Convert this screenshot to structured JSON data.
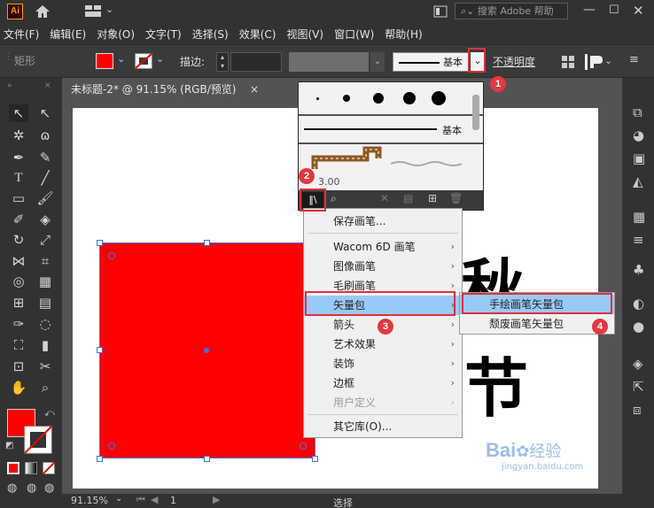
{
  "title_bar": {
    "logo": "Ai",
    "search_placeholder": "搜索 Adobe 帮助"
  },
  "menu": [
    "文件(F)",
    "编辑(E)",
    "对象(O)",
    "文字(T)",
    "选择(S)",
    "效果(C)",
    "视图(V)",
    "窗口(W)",
    "帮助(H)"
  ],
  "control_bar": {
    "shape_label": "矩形",
    "stroke_label": "描边:",
    "brush_profile": "基本",
    "opacity_label": "不透明度",
    "fill_color": "#fe0000"
  },
  "document": {
    "tab_title": "未标题-2* @ 91.15% (RGB/预览)",
    "text_chars": [
      "秋",
      "节"
    ],
    "rect_color": "#fe0000"
  },
  "brush_panel": {
    "basic_label": "基本",
    "size_label": "3.00"
  },
  "context_menu": {
    "items": [
      {
        "label": "保存画笔...",
        "submenu": false,
        "disabled": false
      },
      {
        "label": "Wacom 6D 画笔",
        "submenu": true,
        "disabled": false
      },
      {
        "label": "图像画笔",
        "submenu": true,
        "disabled": false
      },
      {
        "label": "毛刷画笔",
        "submenu": true,
        "disabled": false
      },
      {
        "label": "矢量包",
        "submenu": true,
        "disabled": false,
        "highlight": true
      },
      {
        "label": "箭头",
        "submenu": true,
        "disabled": false
      },
      {
        "label": "艺术效果",
        "submenu": true,
        "disabled": false
      },
      {
        "label": "装饰",
        "submenu": true,
        "disabled": false
      },
      {
        "label": "边框",
        "submenu": true,
        "disabled": false
      },
      {
        "label": "用户定义",
        "submenu": true,
        "disabled": true
      },
      {
        "label": "其它库(O)...",
        "submenu": false,
        "disabled": false
      }
    ],
    "submenu_items": [
      "手绘画笔矢量包",
      "颓废画笔矢量包"
    ]
  },
  "annotations": [
    "1",
    "2",
    "3",
    "4"
  ],
  "status_bar": {
    "zoom": "91.15%",
    "page": "1",
    "mode": "选择"
  },
  "watermark": {
    "brand": "Bai",
    "brand2": "经验",
    "url": "jingyan.baidu.com"
  }
}
